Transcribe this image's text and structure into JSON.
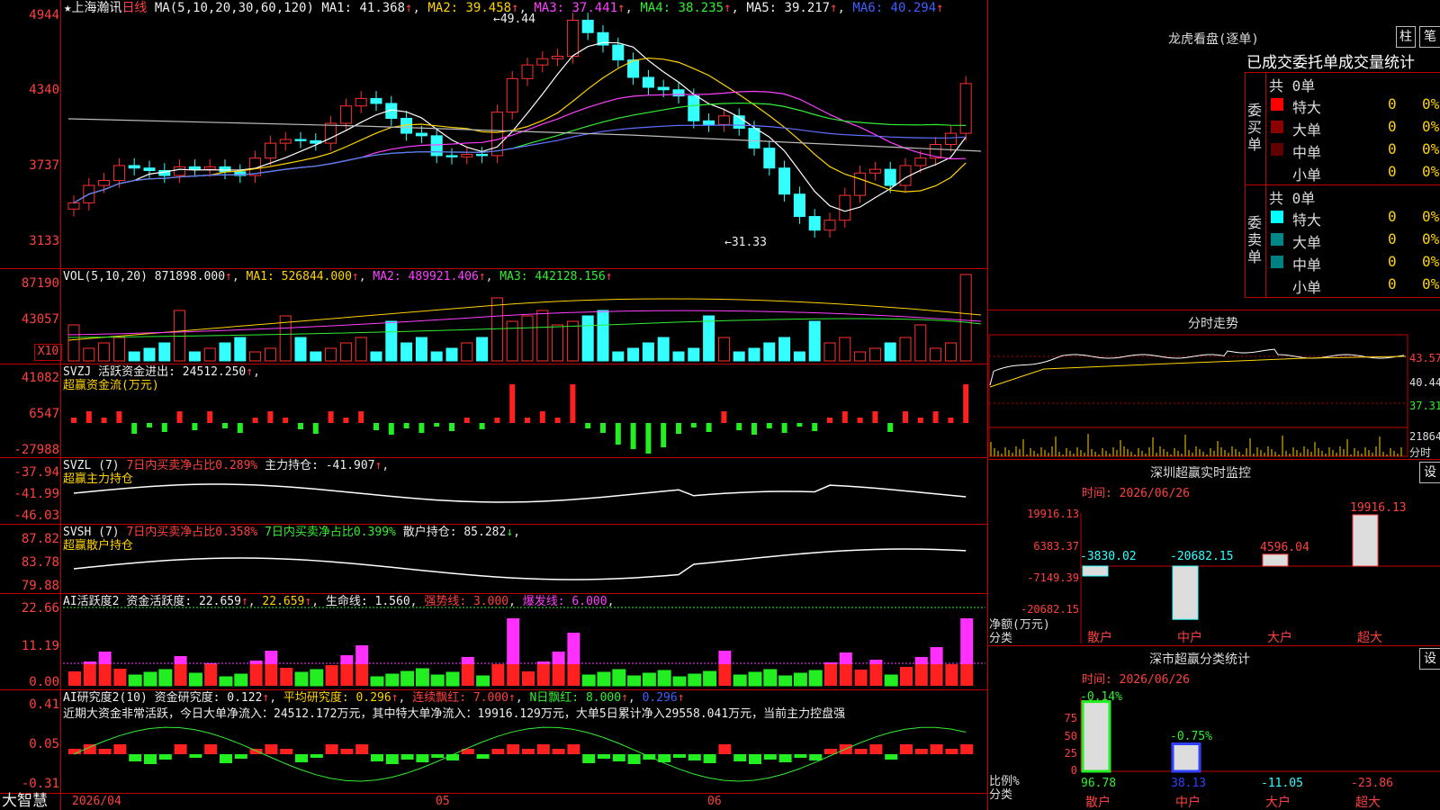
{
  "left_panel": {
    "title_stock": "上海瀚讯",
    "title_period": "日线",
    "ma_header": "MA(5,10,20,30,60,120)",
    "ma1": "MA1: 41.368",
    "ma2": "MA2: 39.458",
    "ma3": "MA3: 37.441",
    "ma4": "MA4: 38.235",
    "ma5": "MA5: 39.217",
    "ma6": "MA6: 40.294",
    "price_axis": [
      "4944",
      "4340",
      "3737",
      "3133"
    ],
    "high_label": "49.44",
    "low_label": "31.33",
    "vol_header": "VOL(5,10,20)",
    "vol_value": "871898.000",
    "vol_ma1": "MA1: 526844.000",
    "vol_ma2": "MA2: 489921.406",
    "vol_ma3": "MA3: 442128.156",
    "vol_axis": [
      "87190",
      "43057"
    ],
    "vol_unit": "X10",
    "svzj_header": "SVZJ",
    "svzj_desc": "活跃资金进出: 24512.250",
    "svzj_title": "超赢资金流(万元)",
    "svzj_axis": [
      "41082",
      "6547",
      "-27988"
    ],
    "svzl_header": "SVZL (7)",
    "svzl_desc": "7日内买卖净占比0.289%",
    "svzl_desc2": "主力持仓: -41.907",
    "svzl_title": "超赢主力持仓",
    "svzl_axis": [
      "-37.94",
      "-41.99",
      "-46.03"
    ],
    "svsh_header": "SVSH (7)",
    "svsh_desc": "7日内买卖净占比0.358%",
    "svsh_desc2": "7日内买卖净占比0.399%",
    "svsh_desc3": "散户持仓: 85.282",
    "svsh_title": "超赢散户持仓",
    "svsh_axis": [
      "87.82",
      "83.78",
      "79.88"
    ],
    "ai1_header": "AI活跃度2",
    "ai1_v1": "资金活跃度: 22.659",
    "ai1_v2": "22.659",
    "ai1_v3": "生命线: 1.560",
    "ai1_v4": "强势线: 3.000",
    "ai1_v5": "爆发线: 6.000",
    "ai1_axis": [
      "22.66",
      "11.19",
      "0.00"
    ],
    "ai2_header": "AI研究度2(10)",
    "ai2_v1": "资金研究度: 0.122",
    "ai2_v2": "平均研究度: 0.296",
    "ai2_v3": "连续飘红: 7.000",
    "ai2_v4": "N日飘红: 8.000",
    "ai2_v5": "0.296",
    "ai2_summary": "近期大资金非常活跃，今日大单净流入：24512.172万元，其中特大单净流入：19916.129万元，大单5日累计净入29558.041万元，当前主力控盘强",
    "ai2_axis": [
      "0.41",
      "0.05",
      "-0.31"
    ],
    "brand": "大智慧",
    "date_start": "2026/04",
    "date_m5": "05",
    "date_m6": "06"
  },
  "right_panel": {
    "lhb_title": "龙虎看盘(逐单)",
    "btn_zhu": "柱",
    "btn_bi": "笔",
    "tabs": "已成交委托单成交量统计",
    "buy_label": "委买单",
    "sell_label": "委卖单",
    "buy_total": "共 0单",
    "sell_total": "共 0单",
    "buy_rows": [
      {
        "name": "特大",
        "count": "0",
        "pct": "0%",
        "color": "#ff0000"
      },
      {
        "name": "大单",
        "count": "0",
        "pct": "0%",
        "color": "#8b0000"
      },
      {
        "name": "中单",
        "count": "0",
        "pct": "0%",
        "color": "#600000"
      },
      {
        "name": "小单",
        "count": "0",
        "pct": "0%",
        "color": ""
      }
    ],
    "sell_rows": [
      {
        "name": "特大",
        "count": "0",
        "pct": "0%",
        "color": "#00ffff"
      },
      {
        "name": "大单",
        "count": "0",
        "pct": "0%",
        "color": "#008888"
      },
      {
        "name": "中单",
        "count": "0",
        "pct": "0%",
        "color": "#008080"
      },
      {
        "name": "小单",
        "count": "0",
        "pct": "0%",
        "color": ""
      }
    ],
    "fs_title": "分时走势",
    "fs_axis": [
      "43.57",
      "40.44",
      "37.31",
      "21864",
      "分时"
    ],
    "sz_title": "深圳超赢实时监控",
    "sz_set": "设",
    "sz_time": "时间: 2026/06/26",
    "sz_axis": [
      "19916.13",
      "6383.37",
      "-7149.39",
      "-20682.15"
    ],
    "sz_footer": "净额(万元)",
    "sz_footer2": "分类",
    "sz_cats": [
      "散户",
      "中户",
      "大户",
      "超大"
    ],
    "sz_values": [
      "-3830.02",
      "-20682.15",
      "4596.04",
      "19916.13"
    ],
    "cls_title": "深市超赢分类统计",
    "cls_set": "设",
    "cls_time": "时间: 2026/06/26",
    "cls_axis": [
      "75",
      "50",
      "25",
      "0"
    ],
    "cls_top": [
      "-0.14%",
      "-0.75%"
    ],
    "cls_bottom": [
      "96.78",
      "38.13",
      "-11.05",
      "-23.86"
    ],
    "cls_footer": "比例%",
    "cls_footer2": "分类",
    "cls_cats": [
      "散户",
      "中户",
      "大户",
      "超大"
    ]
  }
}
